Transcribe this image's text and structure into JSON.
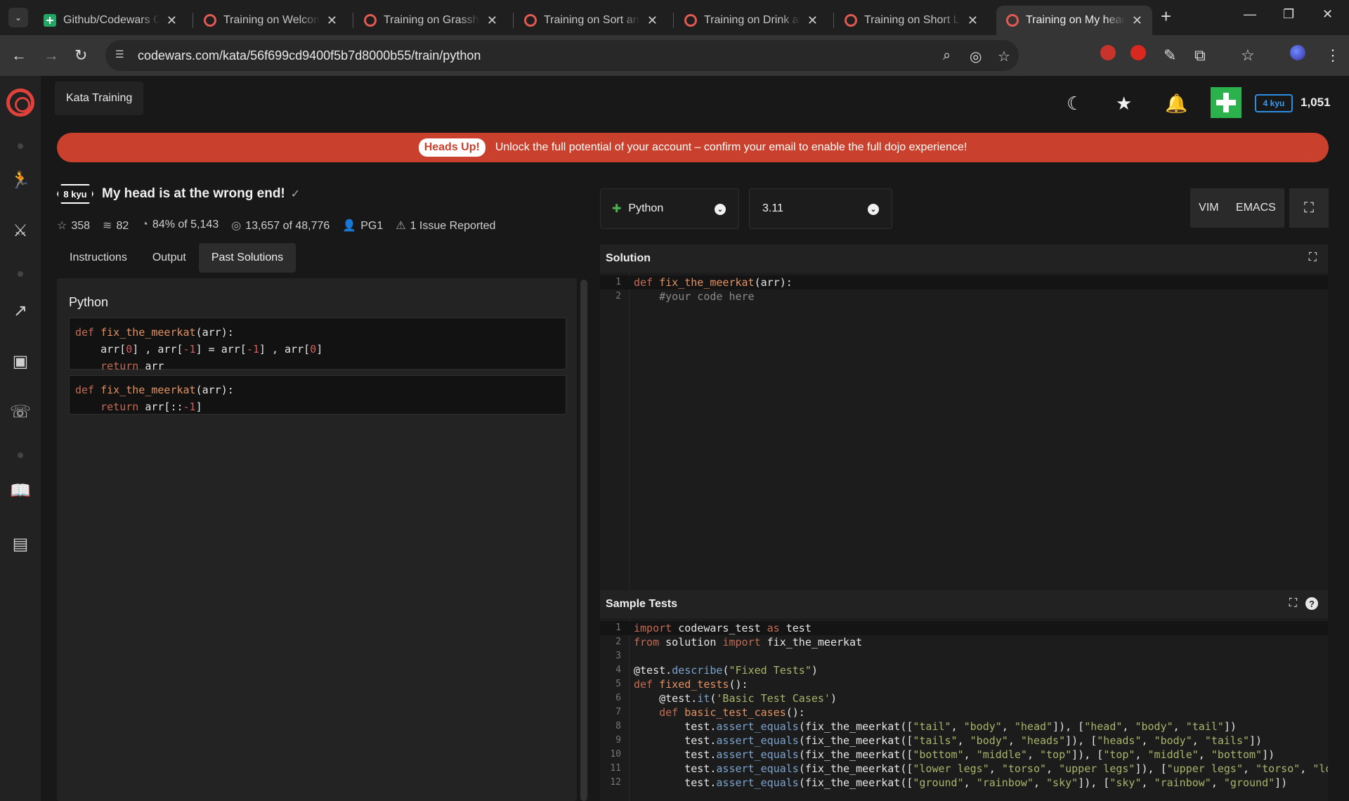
{
  "browser": {
    "tabs": [
      {
        "title": "Github/Codewars Ch",
        "type": "sheet"
      },
      {
        "title": "Training on Welcome",
        "type": "cw"
      },
      {
        "title": "Training on Grasshop",
        "type": "cw"
      },
      {
        "title": "Training on Sort and",
        "type": "cw"
      },
      {
        "title": "Training on Drink ab",
        "type": "cw"
      },
      {
        "title": "Training on Short Lo",
        "type": "cw"
      },
      {
        "title": "Training on My head",
        "type": "cw"
      }
    ],
    "url": "codewars.com/kata/56f699cd9400f5b7d8000b55/train/python"
  },
  "header": {
    "breadcrumb": "Kata Training",
    "rank": "4 kyu",
    "honor": "1,051"
  },
  "banner": {
    "pill": "Heads Up!",
    "message": "Unlock the full potential of your account – confirm your email to enable the full dojo experience!"
  },
  "kata": {
    "kyu": "8 kyu",
    "title": "My head is at the wrong end!",
    "check": "✓",
    "stars": "358",
    "collections": "82",
    "satisfaction": "84% of 5,143",
    "completions": "13,657 of 48,776",
    "author": "PG1",
    "issues": "1 Issue Reported"
  },
  "subtabs": [
    "Instructions",
    "Output",
    "Past Solutions"
  ],
  "past_solutions": {
    "language": "Python",
    "solutions": [
      [
        "def fix_the_meerkat(arr):",
        "    arr[0] , arr[-1] = arr[-1] , arr[0]",
        "    return arr"
      ],
      [
        "def fix_the_meerkat(arr):",
        "    return arr[::-1]"
      ]
    ]
  },
  "editor_controls": {
    "language": "Python",
    "version": "3.11",
    "vim": "VIM",
    "emacs": "EMACS"
  },
  "solution_editor": {
    "title": "Solution",
    "lines": [
      "def fix_the_meerkat(arr):",
      "    #your code here"
    ]
  },
  "sample_tests": {
    "title": "Sample Tests",
    "lines": [
      "import codewars_test as test",
      "from solution import fix_the_meerkat",
      "",
      "@test.describe(\"Fixed Tests\")",
      "def fixed_tests():",
      "    @test.it('Basic Test Cases')",
      "    def basic_test_cases():",
      "        test.assert_equals(fix_the_meerkat([\"tail\", \"body\", \"head\"]), [\"head\", \"body\", \"tail\"])",
      "        test.assert_equals(fix_the_meerkat([\"tails\", \"body\", \"heads\"]), [\"heads\", \"body\", \"tails\"])",
      "        test.assert_equals(fix_the_meerkat([\"bottom\", \"middle\", \"top\"]), [\"top\", \"middle\", \"bottom\"])",
      "        test.assert_equals(fix_the_meerkat([\"lower legs\", \"torso\", \"upper legs\"]), [\"upper legs\", \"torso\", \"lower legs\"])",
      "        test.assert_equals(fix_the_meerkat([\"ground\", \"rainbow\", \"sky\"]), [\"sky\", \"rainbow\", \"ground\"])"
    ]
  },
  "colors": {
    "accent": "#c9412c",
    "logo": "#e0413a",
    "rank_blue": "#2d8ee6"
  }
}
